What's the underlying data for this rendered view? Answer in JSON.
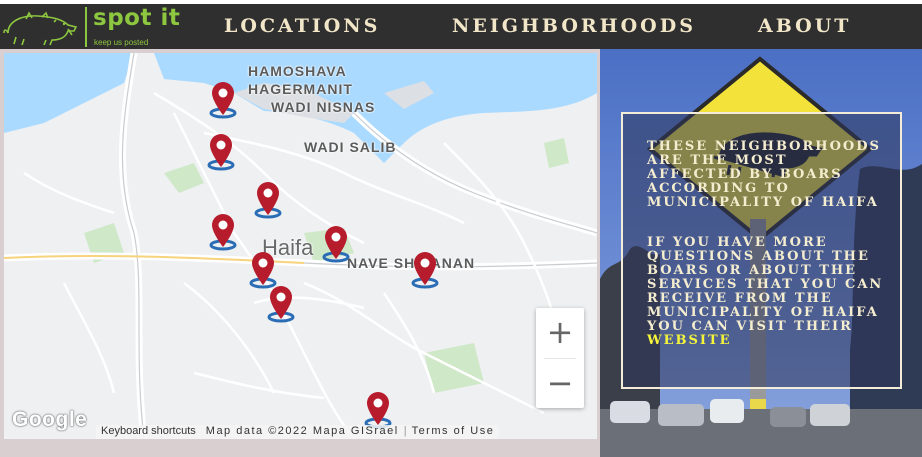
{
  "brand": {
    "title": "spot it",
    "tagline": "keep us posted",
    "color": "#8dc63f"
  },
  "nav": {
    "locations": "LOCATIONS",
    "neighborhoods": "NEIGHBORHOODS",
    "about": "ABOUT"
  },
  "map": {
    "places": {
      "hamoshava": "HAMOSHAVA",
      "hagermanit": "HAGERMANIT",
      "wadi_nisnas": "WADI NISNAS",
      "wadi_salib": "WADI SALIB",
      "nave_shaanan": "NAVE SHA'ANAN",
      "city": "Haifa"
    },
    "pin_color": "#b71c2c",
    "pin_count": 10,
    "zoom_in": "+",
    "zoom_out": "−",
    "google": "Google",
    "attribution": {
      "shortcuts": "Keyboard shortcuts",
      "data": "Map data ©2022 Mapa GISrael",
      "terms": "Terms of Use"
    }
  },
  "info": {
    "p1": "These neighborhoods are the most affected by boars according to municipality of Haifa",
    "p2_before": "If you have more questions about the boars or about the services that you can receive from the municipality of Haifa you can visit their ",
    "p2_link": "website"
  },
  "icons": [
    "boar-logo-icon",
    "map-pin-icon",
    "boar-sign-icon"
  ]
}
